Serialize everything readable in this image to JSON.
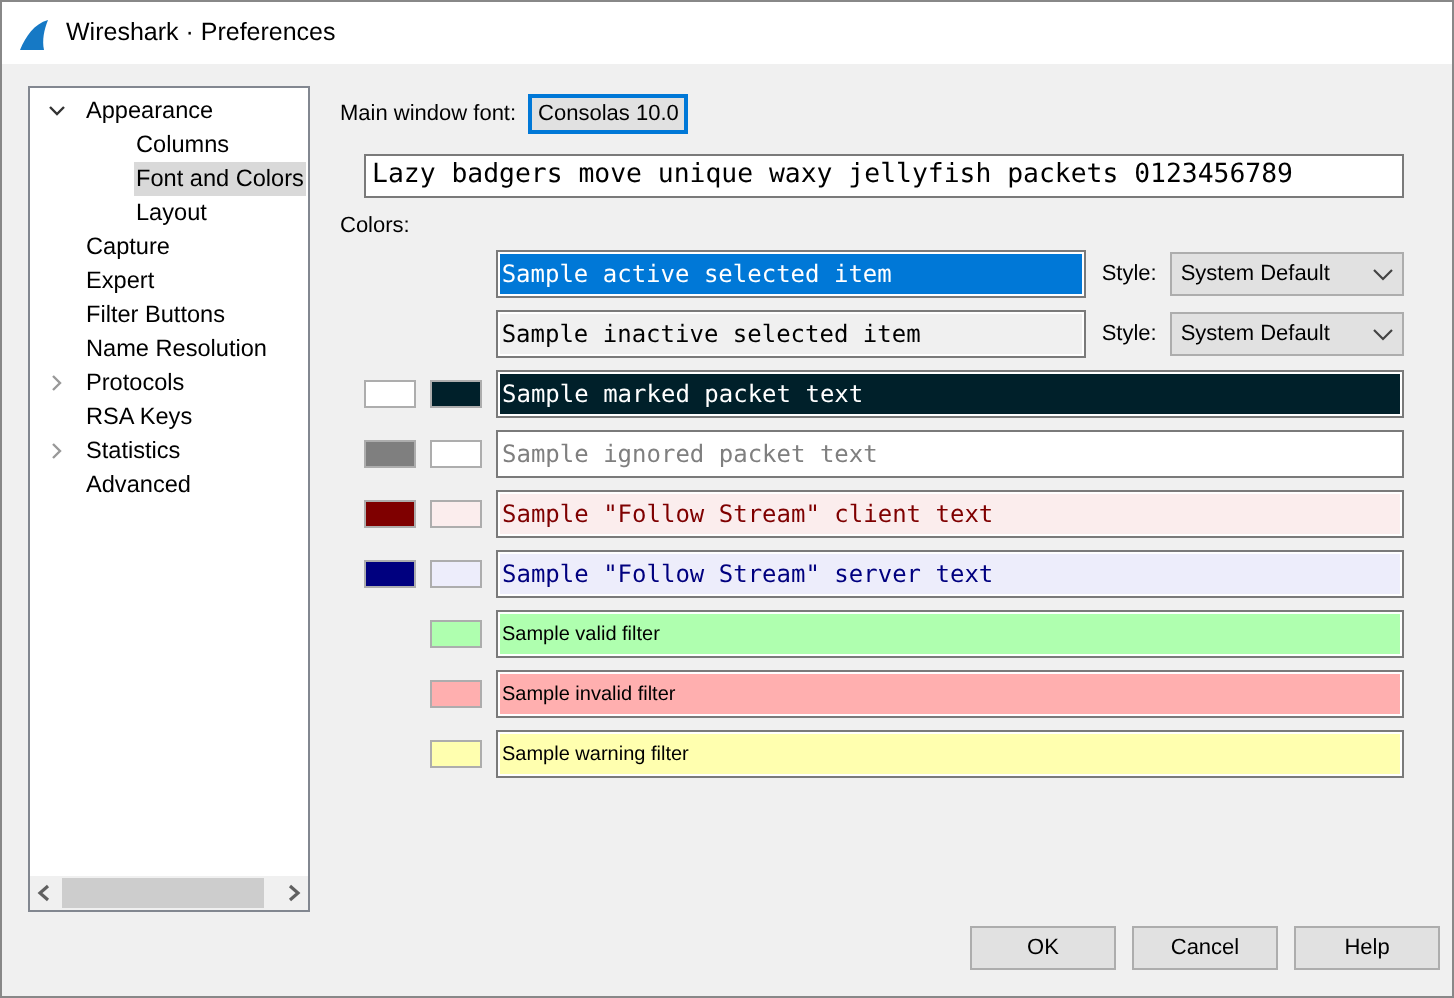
{
  "window": {
    "title": "Wireshark · Preferences"
  },
  "tree": [
    {
      "label": "Appearance",
      "expanded": true,
      "selected": false,
      "children": [
        {
          "label": "Columns",
          "selected": false
        },
        {
          "label": "Font and Colors",
          "selected": true
        },
        {
          "label": "Layout",
          "selected": false
        }
      ]
    },
    {
      "label": "Capture",
      "selected": false
    },
    {
      "label": "Expert",
      "selected": false
    },
    {
      "label": "Filter Buttons",
      "selected": false
    },
    {
      "label": "Name Resolution",
      "selected": false
    },
    {
      "label": "Protocols",
      "expanded": false,
      "selected": false
    },
    {
      "label": "RSA Keys",
      "selected": false
    },
    {
      "label": "Statistics",
      "expanded": false,
      "selected": false
    },
    {
      "label": "Advanced",
      "selected": false
    }
  ],
  "font": {
    "label": "Main window font:",
    "button": "Consolas  10.0",
    "sample": "Lazy badgers move unique waxy jellyfish packets 0123456789"
  },
  "colors_label": "Colors:",
  "color_rows": [
    {
      "kind": "selection",
      "text": "Sample active selected item",
      "foreground": {
        "color": "#ffffff"
      },
      "background": {
        "color": "#0078d7"
      },
      "style_label": "Style:",
      "style": "System Default"
    },
    {
      "kind": "selection",
      "text": "Sample inactive selected item",
      "foreground": {
        "color": "#000000"
      },
      "background": {
        "color": "#f0f0f0"
      },
      "style_label": "Style:",
      "style": "System Default"
    },
    {
      "kind": "packet",
      "text": "Sample marked packet text",
      "foreground": {
        "color": "#ffffff"
      },
      "background": {
        "color": "#00202a"
      }
    },
    {
      "kind": "packet",
      "text": "Sample ignored packet text",
      "foreground": {
        "color": "#7f7f7f"
      },
      "background": {
        "color": "#ffffff"
      }
    },
    {
      "kind": "packet",
      "text": "Sample \"Follow Stream\" client text",
      "foreground": {
        "color": "#7f0000"
      },
      "background": {
        "color": "#fbeded"
      }
    },
    {
      "kind": "packet",
      "text": "Sample \"Follow Stream\" server text",
      "foreground": {
        "color": "#00007f"
      },
      "background": {
        "color": "#ededfb"
      }
    },
    {
      "kind": "filter",
      "text": "Sample valid filter",
      "foreground": {
        "color": "#000000"
      },
      "background": {
        "color": "#afffaf"
      }
    },
    {
      "kind": "filter",
      "text": "Sample invalid filter",
      "foreground": {
        "color": "#000000"
      },
      "background": {
        "color": "#ffafaf"
      }
    },
    {
      "kind": "filter",
      "text": "Sample warning filter",
      "foreground": {
        "color": "#000000"
      },
      "background": {
        "color": "#ffffaf"
      }
    }
  ],
  "buttons": [
    "OK",
    "Cancel",
    "Help"
  ]
}
